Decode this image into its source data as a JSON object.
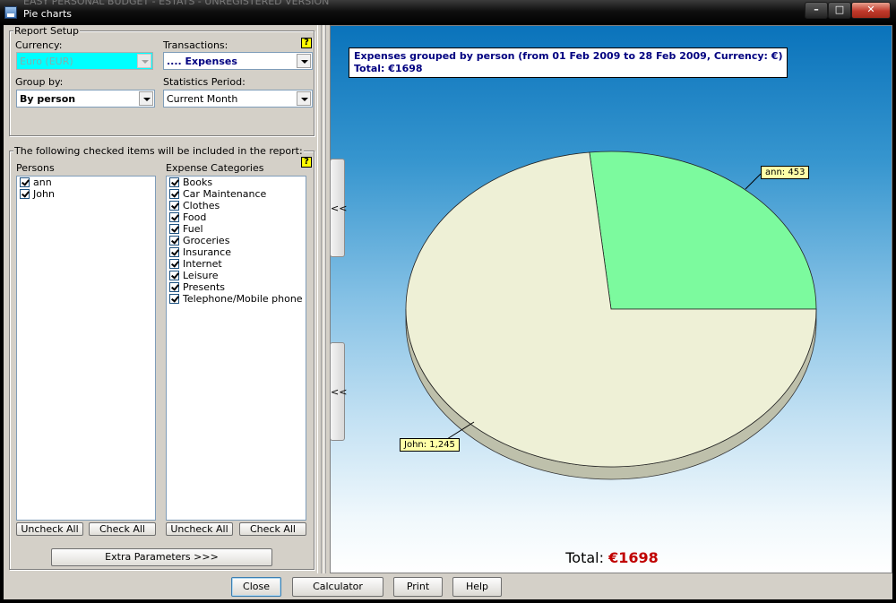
{
  "window": {
    "title": "Pie charts",
    "background_title": "EASY PERSONAL BUDGET - ESTATS - UNREGISTERED VERSION"
  },
  "report_setup": {
    "legend": "Report Setup",
    "currency_label": "Currency:",
    "currency_value": "Euro (EUR)",
    "transactions_label": "Transactions:",
    "transactions_value": ".... Expenses",
    "group_by_label": "Group by:",
    "group_by_value": "By person",
    "period_label": "Statistics Period:",
    "period_value": "Current Month"
  },
  "items": {
    "legend": "The following checked items will be included in the report:",
    "persons_label": "Persons",
    "persons": [
      "ann",
      "John"
    ],
    "categories_label": "Expense Categories",
    "categories": [
      "Books",
      "Car Maintenance",
      "Clothes",
      "Food",
      "Fuel",
      "Groceries",
      "Insurance",
      "Internet",
      "Leisure",
      "Presents",
      "Telephone/Mobile phone"
    ],
    "uncheck_all": "Uncheck All",
    "check_all": "Check All",
    "extra_params": "Extra Parameters >>>"
  },
  "collapse_label": "<<",
  "help_glyph": "?",
  "chart_data": {
    "type": "pie",
    "title": "Expenses grouped by person (from 01 Feb 2009 to 28 Feb 2009, Currency: €)",
    "subtitle": "Total: €1698",
    "slices": [
      {
        "label": "ann",
        "value": 453,
        "display": "ann: 453",
        "color": "#7cfa9e"
      },
      {
        "label": "John",
        "value": 1245,
        "display": "John: 1,245",
        "color": "#eef0d6"
      }
    ],
    "total_label": "Total:",
    "total_value": "€1698"
  },
  "buttons": {
    "close": "Close",
    "calculator": "Calculator",
    "print": "Print",
    "help": "Help"
  }
}
